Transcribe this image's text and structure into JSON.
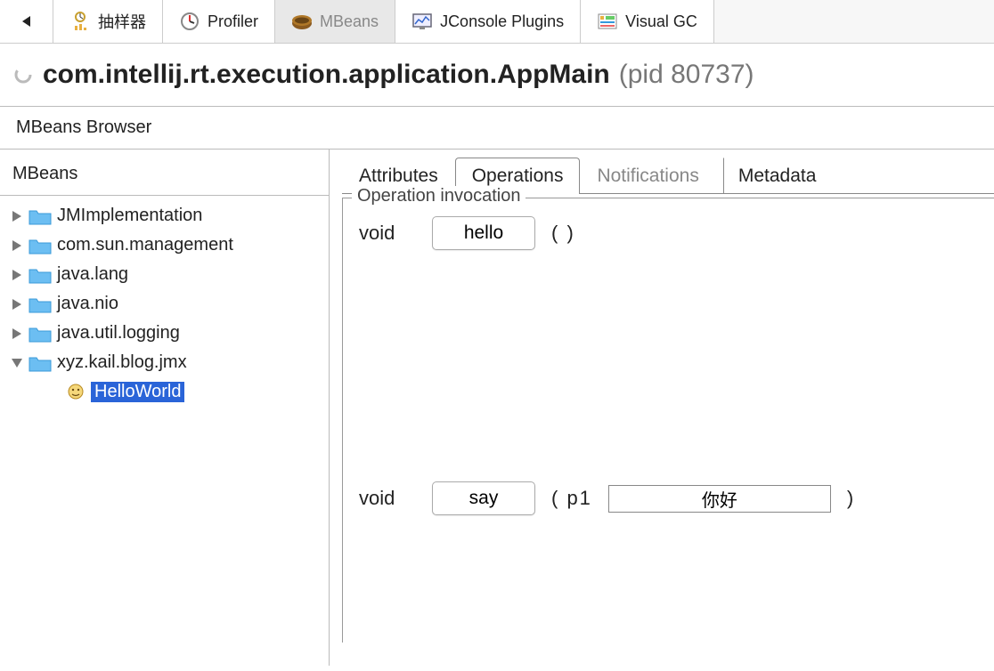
{
  "toolbar": {
    "tabs": [
      {
        "label": "抽样器"
      },
      {
        "label": "Profiler"
      },
      {
        "label": "MBeans"
      },
      {
        "label": "JConsole Plugins"
      },
      {
        "label": "Visual GC"
      }
    ]
  },
  "title": {
    "main": "com.intellij.rt.execution.application.AppMain",
    "pid": "(pid 80737)"
  },
  "subheader": "MBeans Browser",
  "leftPane": {
    "header": "MBeans",
    "tree": [
      {
        "label": "JMImplementation",
        "expanded": false
      },
      {
        "label": "com.sun.management",
        "expanded": false
      },
      {
        "label": "java.lang",
        "expanded": false
      },
      {
        "label": "java.nio",
        "expanded": false
      },
      {
        "label": "java.util.logging",
        "expanded": false
      },
      {
        "label": "xyz.kail.blog.jmx",
        "expanded": true
      }
    ],
    "selectedChild": "HelloWorld"
  },
  "detailTabs": {
    "attributes": "Attributes",
    "operations": "Operations",
    "notifications": "Notifications",
    "metadata": "Metadata"
  },
  "operations": {
    "legend": "Operation invocation",
    "entries": [
      {
        "returnType": "void",
        "name": "hello",
        "params": "( )"
      },
      {
        "returnType": "void",
        "name": "say",
        "paramsPrefix": "( p1",
        "paramValue": "你好",
        "paramsSuffix": ")"
      }
    ]
  }
}
